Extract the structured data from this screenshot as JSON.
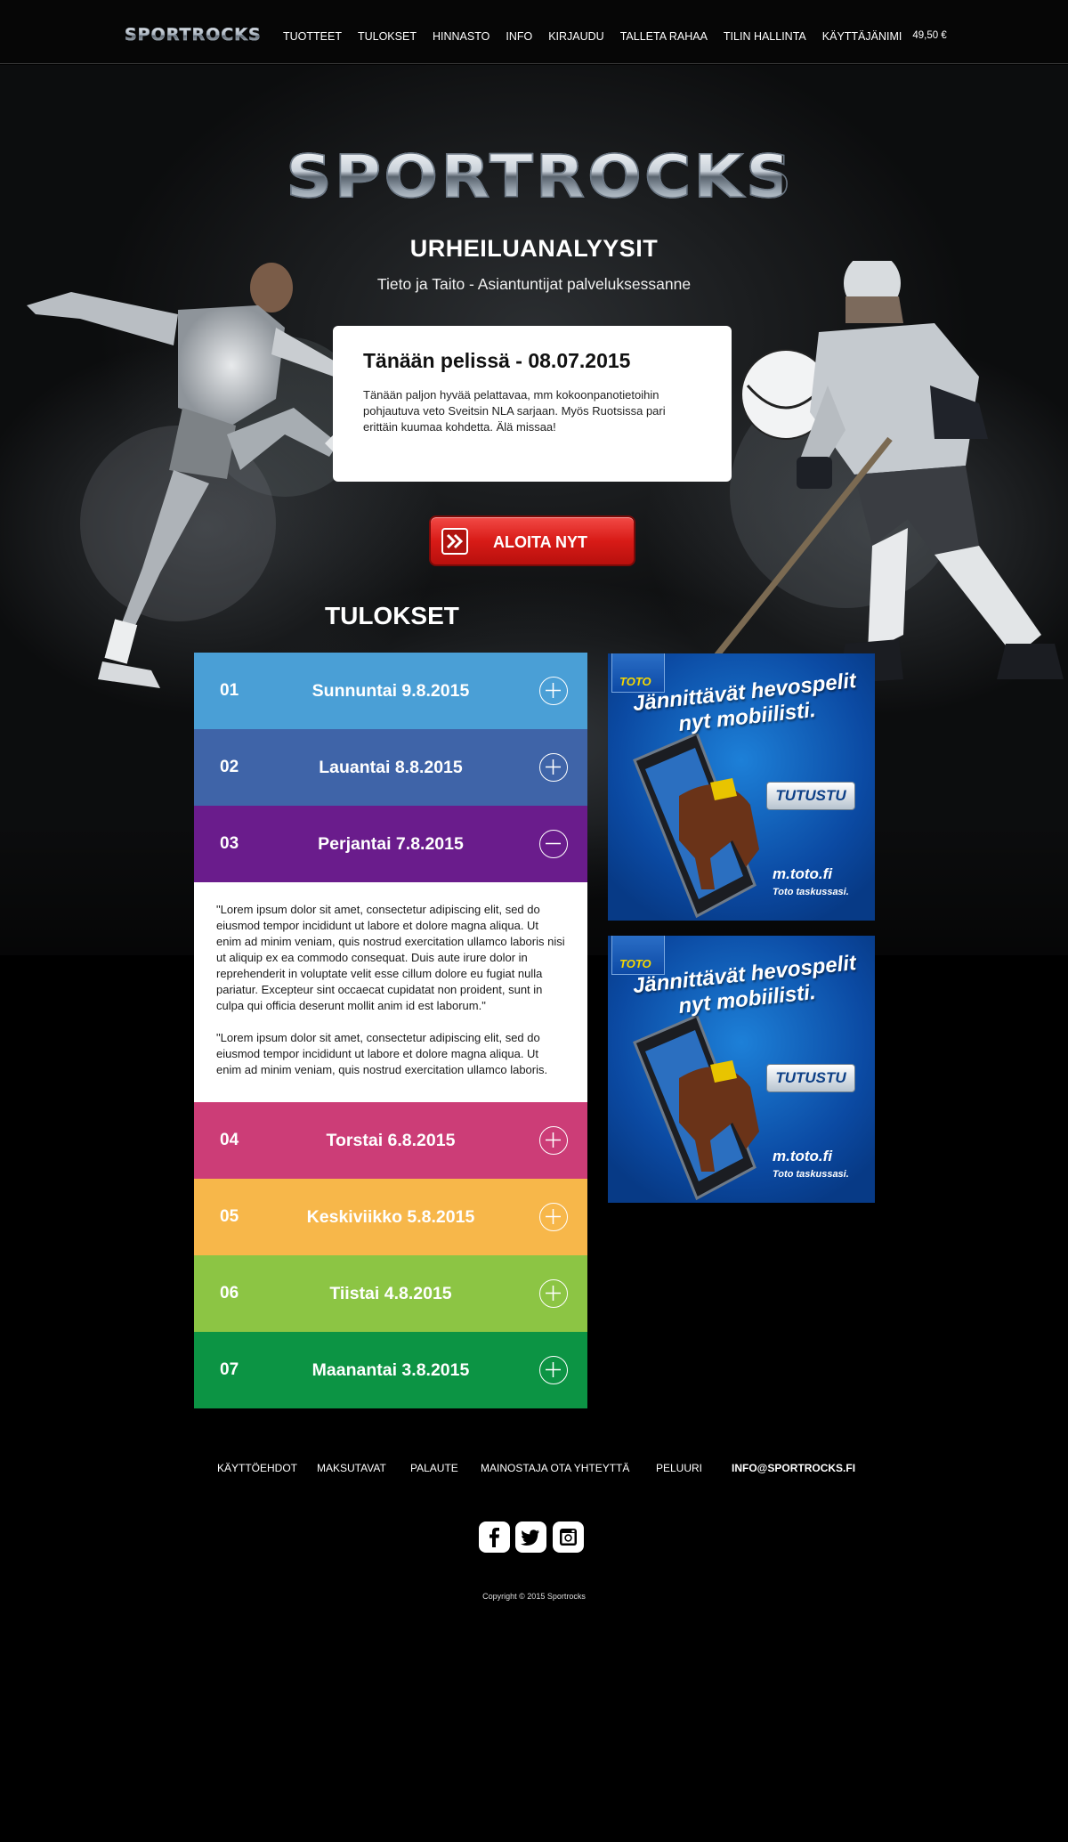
{
  "nav": {
    "logo": "SPORTROCKS",
    "items": [
      "TUOTTEET",
      "TULOKSET",
      "HINNASTO",
      "INFO",
      "KIRJAUDU",
      "TALLETA RAHAA",
      "TILIN HALLINTA",
      "KÄYTTÄJÄNIMI"
    ],
    "balance": "49,50 €"
  },
  "hero": {
    "logo": "SPORTROCKS",
    "title": "URHEILUANALYYSIT",
    "subtitle": "Tieto ja Taito - Asiantuntijat palveluksessanne"
  },
  "today": {
    "title": "Tänään pelissä - 08.07.2015",
    "text": "Tänään paljon hyvää pelattavaa, mm kokoonpanotietoihin pohjautuva veto Sveitsin NLA sarjaan. Myös Ruotsissa pari erittäin kuumaa kohdetta. Älä missaa!"
  },
  "cta": {
    "label": "ALOITA NYT",
    "icon": "double-chevron-right-icon"
  },
  "results": {
    "title": "TULOKSET",
    "rows": [
      {
        "num": "01",
        "label": "Sunnuntai 9.8.2015",
        "color": "#4a9fd6",
        "open": false
      },
      {
        "num": "02",
        "label": "Lauantai 8.8.2015",
        "color": "#3f64a8",
        "open": false
      },
      {
        "num": "03",
        "label": "Perjantai 7.8.2015",
        "color": "#6a1c8c",
        "open": true
      },
      {
        "num": "04",
        "label": "Torstai 6.8.2015",
        "color": "#cc3d77",
        "open": false
      },
      {
        "num": "05",
        "label": "Keskiviikko 5.8.2015",
        "color": "#f7b74a",
        "open": false
      },
      {
        "num": "06",
        "label": "Tiistai 4.8.2015",
        "color": "#8cc544",
        "open": false
      },
      {
        "num": "07",
        "label": "Maanantai 3.8.2015",
        "color": "#0c9444",
        "open": false
      }
    ],
    "open_body": [
      "\"Lorem ipsum dolor sit amet, consectetur adipiscing elit, sed do eiusmod tempor incididunt ut labore et dolore magna aliqua. Ut enim ad minim veniam, quis nostrud exercitation ullamco laboris nisi ut aliquip ex ea commodo consequat. Duis aute irure dolor in reprehenderit in voluptate velit esse cillum dolore eu fugiat nulla pariatur. Excepteur sint occaecat cupidatat non proident, sunt in culpa qui officia deserunt mollit anim id est laborum.\"",
      "\"Lorem ipsum dolor sit amet, consectetur adipiscing elit, sed do eiusmod tempor incididunt ut labore et dolore magna aliqua. Ut enim ad minim veniam, quis nostrud exercitation ullamco laboris."
    ]
  },
  "ads": [
    {
      "brand": "TOTO",
      "headline_1": "Jännittävät hevospelit",
      "headline_2": "nyt mobiilisti.",
      "button": "TUTUSTU",
      "url": "m.toto.fi",
      "tagline": "Toto taskussasi."
    },
    {
      "brand": "TOTO",
      "headline_1": "Jännittävät hevospelit",
      "headline_2": "nyt mobiilisti.",
      "button": "TUTUSTU",
      "url": "m.toto.fi",
      "tagline": "Toto taskussasi."
    }
  ],
  "footer": {
    "links": [
      "KÄYTTÖEHDOT",
      "MAKSUTAVAT",
      "PALAUTE",
      "MAINOSTAJA OTA YHTEYTTÄ",
      "PELUURI"
    ],
    "email": "INFO@SPORTROCKS.FI",
    "social": [
      "facebook-icon",
      "twitter-icon",
      "instagram-icon"
    ],
    "copyright": "Copyright © 2015 Sportrocks"
  }
}
